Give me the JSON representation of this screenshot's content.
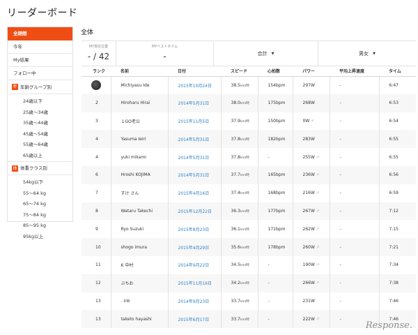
{
  "page": {
    "title": "リーダーボード"
  },
  "sidebar": {
    "items": [
      {
        "label": "全期間",
        "active": true
      },
      {
        "label": "今年",
        "active": false
      },
      {
        "label": "My結果",
        "active": false
      },
      {
        "label": "フォロー中",
        "active": false
      }
    ],
    "age_group": {
      "header": "年齢グループ別",
      "badge": "年",
      "items": [
        "24歳以下",
        "25歳～34歳",
        "35歳～44歳",
        "45歳～54歳",
        "55歳～64歳",
        "65歳以上"
      ]
    },
    "weight_class": {
      "header": "体重クラス別",
      "badge": "体",
      "items": [
        "54kg以下",
        "55～64 kg",
        "65～74 kg",
        "75～84 kg",
        "85～95 kg",
        "95kg以上"
      ]
    }
  },
  "main": {
    "section_title": "全体",
    "summary": {
      "rank_label": "MY現在位置",
      "rank_value": "- / 42",
      "best_label": "MYベストタイム",
      "best_value": "-",
      "filter1": "合計",
      "filter2": "男女",
      "caret": "▼"
    },
    "columns": [
      "ランク",
      "名前",
      "日付",
      "スピード",
      "心拍数",
      "パワー",
      "平均上昇速度",
      "タイム"
    ],
    "rows": [
      {
        "rank": "",
        "name": "Michiyasu Ide",
        "date": "2015年10月24日",
        "speed": "38.5",
        "unit": "km/時",
        "hr": "154bpm",
        "power": "297W",
        "flag": "",
        "climb": "-",
        "time": "6:47"
      },
      {
        "rank": "2",
        "name": "Hiroharu Hirai",
        "date": "2014年5月31日",
        "speed": "38.0",
        "unit": "km/時",
        "hr": "175bpm",
        "power": "268W",
        "flag": "",
        "climb": "-",
        "time": "6:53"
      },
      {
        "rank": "3",
        "name": "１GO老公",
        "date": "2015年11月5日",
        "speed": "37.9",
        "unit": "km/時",
        "hr": "150bpm",
        "power": "0W",
        "flag": "⚡",
        "climb": "-",
        "time": "6:54"
      },
      {
        "rank": "4",
        "name": "Yasuma Ieiri",
        "date": "2014年5月31日",
        "speed": "37.8",
        "unit": "km/時",
        "hr": "182bpm",
        "power": "283W",
        "flag": "",
        "climb": "-",
        "time": "6:55"
      },
      {
        "rank": "4",
        "name": "yuki mikami",
        "date": "2014年5月31日",
        "speed": "37.8",
        "unit": "km/時",
        "hr": "-",
        "power": "255W",
        "flag": "⚡",
        "climb": "-",
        "time": "6:55"
      },
      {
        "rank": "6",
        "name": "Hroshi KOJIMA",
        "date": "2014年5月31日",
        "speed": "37.7",
        "unit": "km/時",
        "hr": "165bpm",
        "power": "236W",
        "flag": "⚡",
        "climb": "-",
        "time": "6:56"
      },
      {
        "rank": "7",
        "name": "すけ さん",
        "date": "2015年4月16日",
        "speed": "37.4",
        "unit": "km/時",
        "hr": "168bpm",
        "power": "216W",
        "flag": "⚡",
        "climb": "-",
        "time": "6:59"
      },
      {
        "rank": "8",
        "name": "Wataru Takechi",
        "date": "2015年12月22日",
        "speed": "36.3",
        "unit": "km/時",
        "hr": "177bpm",
        "power": "267W",
        "flag": "⚡",
        "climb": "-",
        "time": "7:12"
      },
      {
        "rank": "9",
        "name": "Ryo Suzuki",
        "date": "2015年8月23日",
        "speed": "36.1",
        "unit": "km/時",
        "hr": "171bpm",
        "power": "262W",
        "flag": "⚡",
        "climb": "-",
        "time": "7:15"
      },
      {
        "rank": "10",
        "name": "shogo imura",
        "date": "2015年4月29日",
        "speed": "35.6",
        "unit": "km/時",
        "hr": "178bpm",
        "power": "260W",
        "flag": "⚡",
        "climb": "-",
        "time": "7:21"
      },
      {
        "rank": "11",
        "name": "K 中村",
        "date": "2014年9月22日",
        "speed": "34.5",
        "unit": "km/時",
        "hr": "-",
        "power": "190W",
        "flag": "⚡",
        "climb": "-",
        "time": "7:34"
      },
      {
        "rank": "12",
        "name": "ぶちお",
        "date": "2015年11月16日",
        "speed": "34.2",
        "unit": "km/時",
        "hr": "-",
        "power": "266W",
        "flag": "⚡",
        "climb": "-",
        "time": "7:38"
      },
      {
        "rank": "13",
        "name": ". inb",
        "date": "2014年9月23日",
        "speed": "33.7",
        "unit": "km/時",
        "hr": "-",
        "power": "231W",
        "flag": "",
        "climb": "-",
        "time": "7:46"
      },
      {
        "rank": "13",
        "name": "taketo hayashi",
        "date": "2015年6月17日",
        "speed": "33.7",
        "unit": "km/時",
        "hr": "-",
        "power": "222W",
        "flag": "⚡",
        "climb": "-",
        "time": "7:46"
      }
    ]
  },
  "watermark": {
    "text": "Response."
  },
  "colors": {
    "accent": "#f04d14",
    "link": "#2a7fc4",
    "row_alt": "#f7f7f7"
  }
}
